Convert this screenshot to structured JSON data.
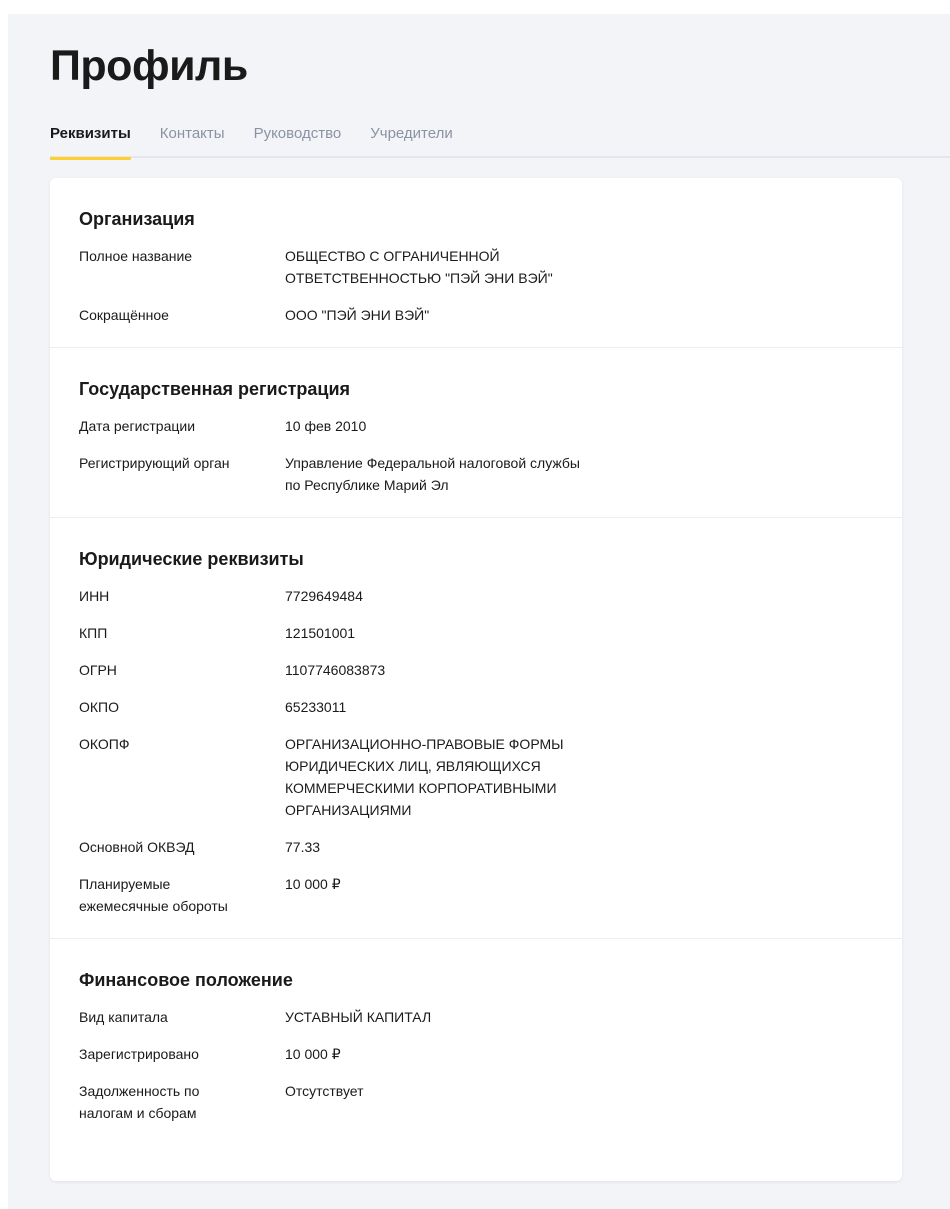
{
  "page": {
    "title": "Профиль"
  },
  "tabs": [
    {
      "label": "Реквизиты",
      "active": true
    },
    {
      "label": "Контакты",
      "active": false
    },
    {
      "label": "Руководство",
      "active": false
    },
    {
      "label": "Учредители",
      "active": false
    }
  ],
  "colors": {
    "accent": "#ffd02b",
    "background": "#f2f4f8",
    "inactive_tab": "#8a93a3"
  },
  "sections": [
    {
      "title": "Организация",
      "rows": [
        {
          "label": "Полное название",
          "value": "ОБЩЕСТВО С ОГРАНИЧЕННОЙ\nОТВЕТСТВЕННОСТЬЮ \"ПЭЙ ЭНИ ВЭЙ\""
        },
        {
          "label": "Сокращённое",
          "value": "ООО \"ПЭЙ ЭНИ ВЭЙ\""
        }
      ]
    },
    {
      "title": "Государственная регистрация",
      "rows": [
        {
          "label": "Дата регистрации",
          "value": "10 фев 2010"
        },
        {
          "label": "Регистрирующий орган",
          "value": "Управление Федеральной налоговой службы\nпо Республике Марий Эл"
        }
      ]
    },
    {
      "title": "Юридические реквизиты",
      "rows": [
        {
          "label": "ИНН",
          "value": "7729649484"
        },
        {
          "label": "КПП",
          "value": "121501001"
        },
        {
          "label": "ОГРН",
          "value": "1107746083873"
        },
        {
          "label": "ОКПО",
          "value": "65233011"
        },
        {
          "label": "ОКОПФ",
          "value": "ОРГАНИЗАЦИОННО-ПРАВОВЫЕ ФОРМЫ\nЮРИДИЧЕСКИХ ЛИЦ, ЯВЛЯЮЩИХСЯ\nКОММЕРЧЕСКИМИ КОРПОРАТИВНЫМИ\nОРГАНИЗАЦИЯМИ"
        },
        {
          "label": "Основной ОКВЭД",
          "value": "77.33"
        },
        {
          "label": "Планируемые\nежемесячные обороты",
          "value": "10 000 ₽"
        }
      ]
    },
    {
      "title": "Финансовое положение",
      "rows": [
        {
          "label": "Вид капитала",
          "value": "УСТАВНЫЙ КАПИТАЛ"
        },
        {
          "label": "Зарегистрировано",
          "value": "10 000 ₽"
        },
        {
          "label": "Задолженность по\nналогам и сборам",
          "value": "Отсутствует"
        }
      ]
    }
  ]
}
